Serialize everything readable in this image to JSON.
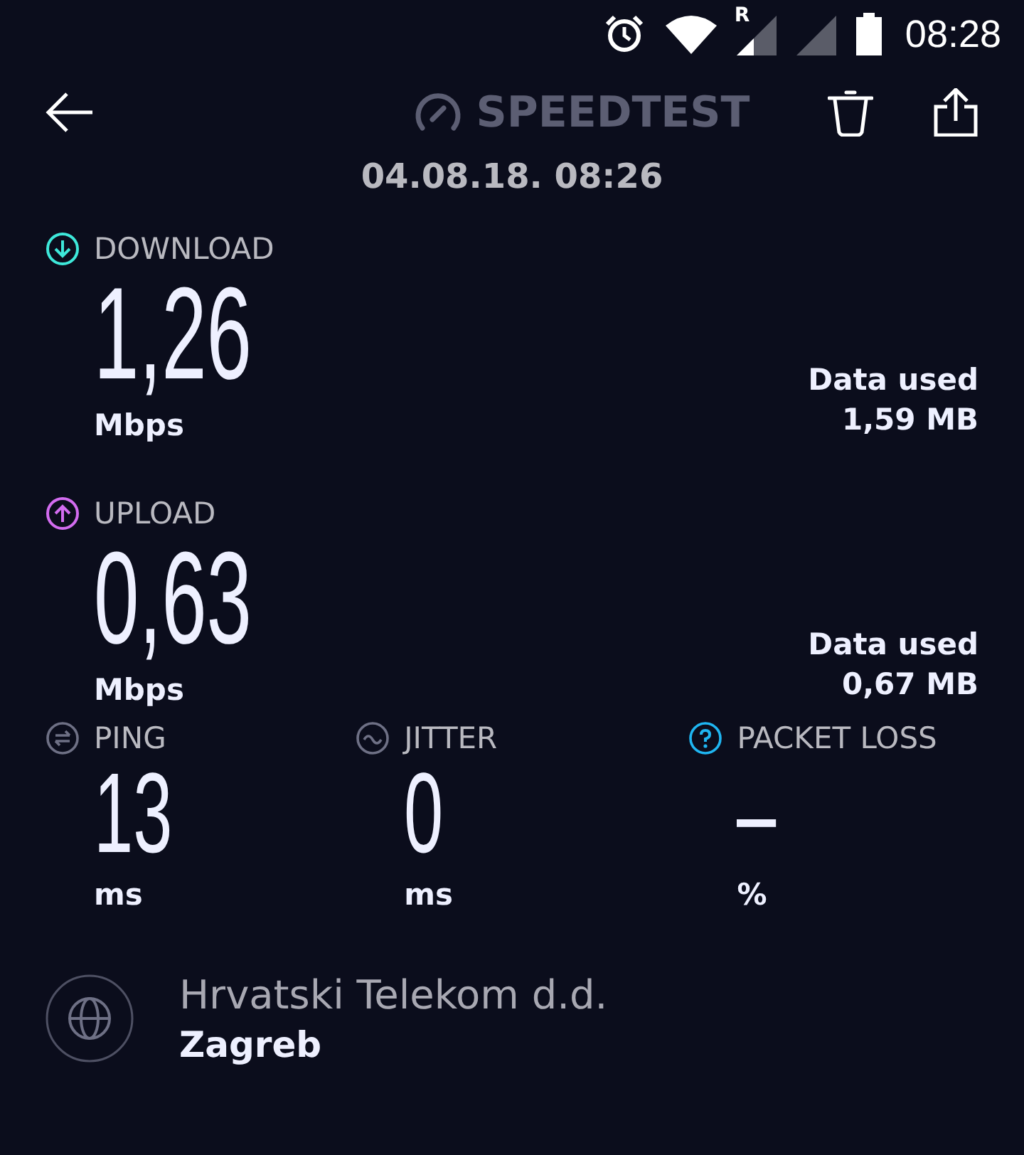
{
  "status_bar": {
    "roaming_label": "R",
    "time": "08:28"
  },
  "header": {
    "title": "SPEEDTEST",
    "date": "04.08.18. 08:26"
  },
  "results": [
    {
      "kind": "download",
      "label": "DOWNLOAD",
      "color": "#3ee8da",
      "value": "1,26",
      "unit": "Mbps",
      "data_used_label": "Data used",
      "data_used": "1,59 MB"
    },
    {
      "kind": "upload",
      "label": "UPLOAD",
      "color": "#d36cf0",
      "value": "0,63",
      "unit": "Mbps",
      "data_used_label": "Data used",
      "data_used": "0,67 MB"
    }
  ],
  "metrics": [
    {
      "kind": "ping",
      "label": "PING",
      "color": "#6e7085",
      "value": "13",
      "unit": "ms"
    },
    {
      "kind": "jitter",
      "label": "JITTER",
      "color": "#6e7085",
      "value": "0",
      "unit": "ms"
    },
    {
      "kind": "packet_loss",
      "label": "PACKET LOSS",
      "color": "#1fb6f2",
      "value": "–",
      "unit": "%"
    }
  ],
  "provider": {
    "name": "Hrvatski Telekom d.d.",
    "location": "Zagreb"
  }
}
